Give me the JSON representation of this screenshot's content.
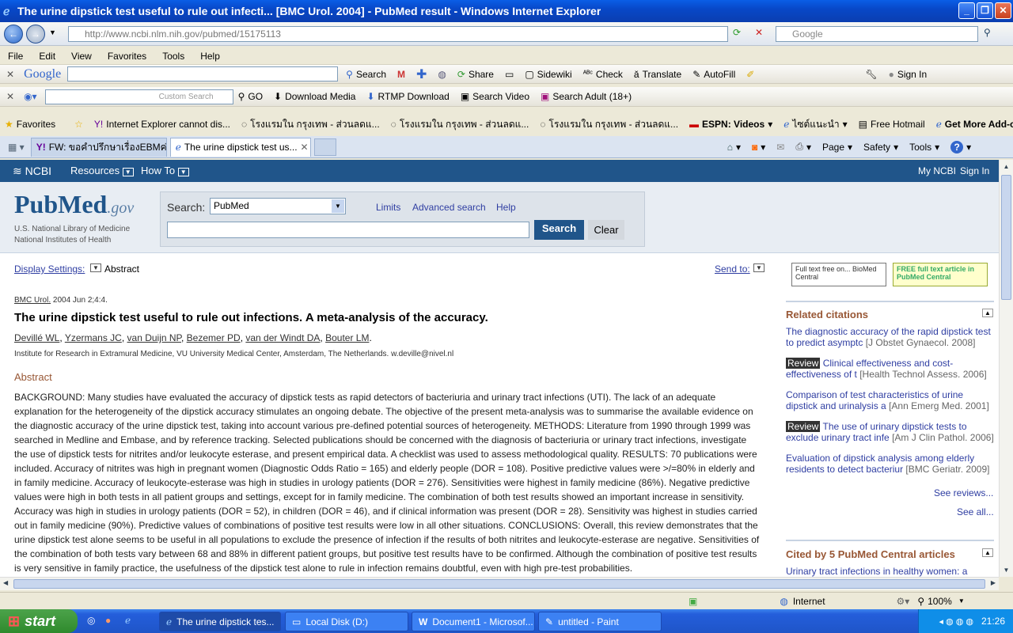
{
  "window": {
    "title": "The urine dipstick test useful to rule out infecti... [BMC Urol. 2004] - PubMed result - Windows Internet Explorer"
  },
  "address": {
    "url": "http://www.ncbi.nlm.nih.gov/pubmed/15175113",
    "search_placeholder": "Google"
  },
  "menu": [
    "File",
    "Edit",
    "View",
    "Favorites",
    "Tools",
    "Help"
  ],
  "google_toolbar": {
    "logo": "Google",
    "search": "Search",
    "share": "Share",
    "sidewiki": "Sidewiki",
    "check": "Check",
    "translate": "Translate",
    "autofill": "AutoFill",
    "signin": "Sign In"
  },
  "toolbar2": {
    "custom_search": "Custom Search",
    "go": "GO",
    "download_media": "Download Media",
    "rtmp": "RTMP Download",
    "search_video": "Search Video",
    "search_adult": "Search Adult (18+)"
  },
  "favorites": {
    "label": "Favorites",
    "items": [
      "Internet Explorer cannot dis...",
      "โรงแรมใน กรุงเทพ - ส่วนลดแ...",
      "โรงแรมใน กรุงเทพ - ส่วนลดแ...",
      "โรงแรมใน กรุงเทพ - ส่วนลดแ...",
      "ESPN: Videos",
      "ไซต์แนะนำ",
      "Free Hotmail",
      "Get More Add-ons"
    ]
  },
  "tabs": [
    {
      "label": "FW: ขอคำปรึกษาเรื่องEBMค่ะ ..."
    },
    {
      "label": "The urine dipstick test us..."
    }
  ],
  "cmdbar": {
    "page": "Page",
    "safety": "Safety",
    "tools": "Tools"
  },
  "ncbi": {
    "logo": "NCBI",
    "resources": "Resources",
    "howto": "How To",
    "myncbi": "My NCBI",
    "signin": "Sign In"
  },
  "pubmed": {
    "logo_pub": "Pub",
    "logo_med": "Med",
    "logo_gov": ".gov",
    "nlm": "U.S. National Library of Medicine",
    "nih": "National Institutes of Health",
    "search_label": "Search:",
    "db": "PubMed",
    "limits": "Limits",
    "advanced": "Advanced search",
    "help": "Help",
    "search_btn": "Search",
    "clear_btn": "Clear"
  },
  "display": {
    "settings": "Display Settings:",
    "mode": "Abstract",
    "sendto": "Send to:"
  },
  "article": {
    "journal": "BMC Urol.",
    "cite": " 2004 Jun 2;4:4.",
    "title": "The urine dipstick test useful to rule out infections. A meta-analysis of the accuracy.",
    "authors": [
      "Devillé WL",
      "Yzermans JC",
      "van Duijn NP",
      "Bezemer PD",
      "van der Windt DA",
      "Bouter LM"
    ],
    "affiliation": "Institute for Research in Extramural Medicine, VU University Medical Center, Amsterdam, The Netherlands. w.deville@nivel.nl",
    "abstract_heading": "Abstract",
    "abstract": "BACKGROUND: Many studies have evaluated the accuracy of dipstick tests as rapid detectors of bacteriuria and urinary tract infections (UTI). The lack of an adequate explanation for the heterogeneity of the dipstick accuracy stimulates an ongoing debate. The objective of the present meta-analysis was to summarise the available evidence on the diagnostic accuracy of the urine dipstick test, taking into account various pre-defined potential sources of heterogeneity. METHODS: Literature from 1990 through 1999 was searched in Medline and Embase, and by reference tracking. Selected publications should be concerned with the diagnosis of bacteriuria or urinary tract infections, investigate the use of dipstick tests for nitrites and/or leukocyte esterase, and present empirical data. A checklist was used to assess methodological quality. RESULTS: 70 publications were included. Accuracy of nitrites was high in pregnant women (Diagnostic Odds Ratio = 165) and elderly people (DOR = 108). Positive predictive values were >/=80% in elderly and in family medicine. Accuracy of leukocyte-esterase was high in studies in urology patients (DOR = 276). Sensitivities were highest in family medicine (86%). Negative predictive values were high in both tests in all patient groups and settings, except for in family medicine. The combination of both test results showed an important increase in sensitivity. Accuracy was high in studies in urology patients (DOR = 52), in children (DOR = 46), and if clinical information was present (DOR = 28). Sensitivity was highest in studies carried out in family medicine (90%). Predictive values of combinations of positive test results were low in all other situations. CONCLUSIONS: Overall, this review demonstrates that the urine dipstick test alone seems to be useful in all populations to exclude the presence of infection if the results of both nitrites and leukocyte-esterase are negative. Sensitivities of the combination of both tests vary between 68 and 88% in different patient groups, but positive test results have to be confirmed. Although the combination of positive test results is very sensitive in family practice, the usefulness of the dipstick test alone to rule in infection remains doubtful, even with high pre-test probabilities."
  },
  "sidebar": {
    "biomed": "Full text free on... BioMed Central",
    "pmc": "FREE full text article in PubMed Central",
    "related_title": "Related citations",
    "related": [
      {
        "badge": "",
        "text": "The diagnostic accuracy of the rapid dipstick test to predict asymptc",
        "journal": "[J Obstet Gynaecol. 2008]"
      },
      {
        "badge": "Review",
        "text": "Clinical effectiveness and cost-effectiveness of t",
        "journal": "[Health Technol Assess. 2006]"
      },
      {
        "badge": "",
        "text": "Comparison of test characteristics of urine dipstick and urinalysis a",
        "journal": "[Ann Emerg Med. 2001]"
      },
      {
        "badge": "Review",
        "text": "The use of urinary dipstick tests to exclude urinary tract infe",
        "journal": "[Am J Clin Pathol. 2006]"
      },
      {
        "badge": "",
        "text": "Evaluation of dipstick analysis among elderly residents to detect bacteriur",
        "journal": "[BMC Geriatr. 2009]"
      }
    ],
    "see_reviews": "See reviews...",
    "see_all": "See all...",
    "cited_title": "Cited by 5 PubMed Central articles",
    "cited_first": "Urinary tract infections in healthy women: a"
  },
  "status": {
    "zone": "Internet",
    "zoom": "100%"
  },
  "taskbar": {
    "start": "start",
    "tasks": [
      "The urine dipstick tes...",
      "Local Disk (D:)",
      "Document1 - Microsof...",
      "untitled - Paint"
    ],
    "time": "21:26"
  }
}
